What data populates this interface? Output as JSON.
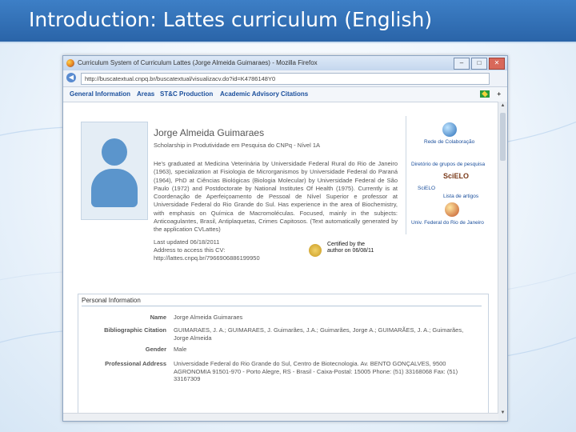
{
  "slide": {
    "title": "Introduction: Lattes curriculum (English)"
  },
  "window": {
    "title": "Curriculum System of Curriculum Lattes (Jorge Almeida Guimaraes) - Mozilla Firefox",
    "minimize": "–",
    "maximize": "□",
    "close": "✕"
  },
  "browser": {
    "url": "http://buscatextual.cnpq.br/buscatextual/visualizacv.do?id=K4786148Y0",
    "back_glyph": "◀"
  },
  "menu": {
    "items": [
      "General Information",
      "Areas",
      "ST&C Production",
      "Academic Advisory",
      "Citations"
    ],
    "plus": "+"
  },
  "profile": {
    "name": "Jorge Almeida Guimaraes",
    "scholarship": "Scholarship in Produtividade em Pesquisa do CNPq - Nível 1A",
    "bio": "He's graduated at Medicina Veterinária by Universidade Federal Rural do Rio de Janeiro (1963), specialization at Fisiologia de Microrganismos by Universidade Federal do Paraná (1964), PhD at Ciências Biológicas (Biologia Molecular) by Universidade Federal de São Paulo (1972) and Postdoctorate by National Institutes Of Health (1975). Currently is at Coordenação de Aperfeiçoamento de Pessoal de Nível Superior e professor at Universidade Federal do Rio Grande do Sul. Has experience in the area of Biochemistry, with emphasis on Química de Macromoléculas. Focused, mainly in the subjects: Anticoagulantes, Brasil, Antiplaquetas, Crimes Capitosos.",
    "auto_note": "(Text automatically generated by the application CVLattes)",
    "last_updated": "Last updated 06/18/2011",
    "cv_address_label": "Address to access this CV:",
    "cv_url": "http://lattes.cnpq.br/7966906886199950",
    "certified": "Certified by the author on 06/08/11"
  },
  "right_panel": {
    "links": [
      "Rede de Colaboração",
      "Diretório de grupos de pesquisa",
      "SciELO",
      "Lista de artigos",
      "Univ. Federal do Rio de Janeiro"
    ],
    "scielo": "SciELO"
  },
  "personal": {
    "title": "Personal Information",
    "fields": [
      {
        "label": "Name",
        "value": "Jorge Almeida Guimaraes"
      },
      {
        "label": "Bibliographic Citation",
        "value": "GUIMARAES, J. A.; GUIMARAES, J. Guimarães, J.A.; Guimarães, Jorge A.; GUIMARÃES, J. A.; Guimarães, Jorge Almeida"
      },
      {
        "label": "Gender",
        "value": "Male"
      },
      {
        "label": "Professional Address",
        "value": "Universidade Federal do Rio Grande do Sul, Centro de Biotecnologia. Av. BENTO GONÇALVES, 9500 AGRONOMIA 91501-970 - Porto Alegre, RS - Brasil - Caixa-Postal: 15005 Phone: (51) 33168068 Fax: (51) 33167309"
      }
    ]
  }
}
